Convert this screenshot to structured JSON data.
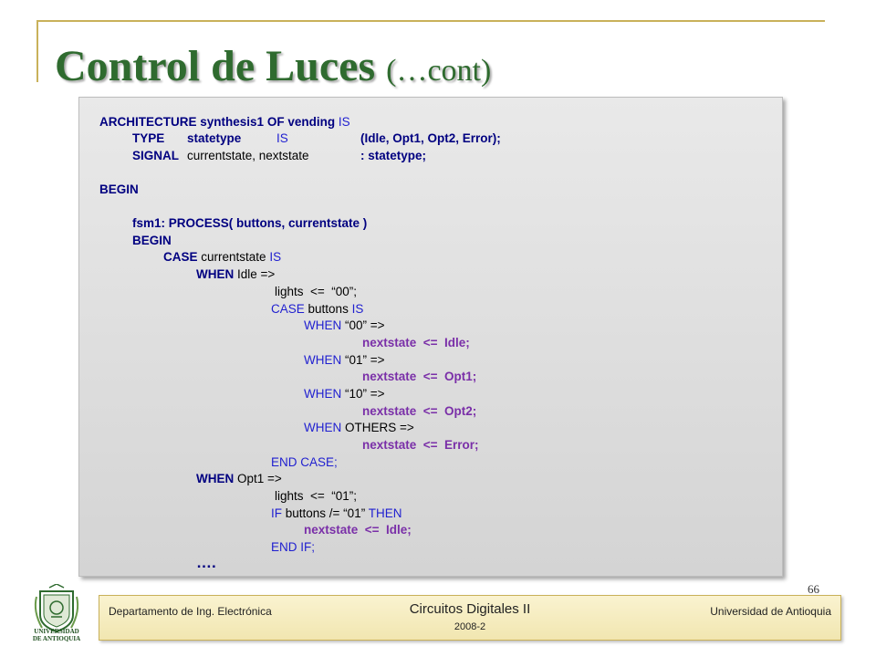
{
  "slide": {
    "title": "Control de Luces",
    "title_suffix": "(…cont)",
    "page_number": "66"
  },
  "code": {
    "l1_a": "ARCHITECTURE",
    "l1_b": "synthesis1",
    "l1_c": "OF",
    "l1_d": "vending",
    "l1_e": "IS",
    "l2_a": "TYPE",
    "l2_b": "statetype",
    "l2_c": "IS",
    "l2_d": "(Idle, Opt1, Opt2, Error);",
    "l3_a": "SIGNAL",
    "l3_b": "currentstate, nextstate",
    "l3_c": ": statetype;",
    "l4": "BEGIN",
    "l5": "fsm1: PROCESS( buttons, currentstate )",
    "l6": "BEGIN",
    "l7_a": "CASE",
    "l7_b": "currentstate",
    "l7_c": "IS",
    "l8_a": "WHEN",
    "l8_b": "Idle =>",
    "l9": "lights  <=  “00”;",
    "l10_a": "CASE",
    "l10_b": "buttons",
    "l10_c": "IS",
    "l11_a": "WHEN",
    "l11_b": "“00” =>",
    "l12": "nextstate  <=  Idle;",
    "l13_a": "WHEN",
    "l13_b": "“01” =>",
    "l14": "nextstate  <=  Opt1;",
    "l15_a": "WHEN",
    "l15_b": "“10” =>",
    "l16": "nextstate  <=  Opt2;",
    "l17_a": "WHEN",
    "l17_b": "OTHERS =>",
    "l18": "nextstate  <=  Error;",
    "l19": "END CASE;",
    "l20_a": "WHEN",
    "l20_b": "Opt1 =>",
    "l21": "lights  <=  “01”;",
    "l22_a": "IF",
    "l22_b": "buttons /= “01”",
    "l22_c": "THEN",
    "l23": "nextstate  <=  Idle;",
    "l24": "END IF;",
    "l25": "…."
  },
  "footer": {
    "department": "Departamento de Ing. Electrónica",
    "course": "Circuitos Digitales II",
    "semester": "2008-2",
    "university": "Universidad de Antioquia",
    "logo_text_line1": "UNIVERSIDAD",
    "logo_text_line2": "DE ANTIOQUIA"
  },
  "colors": {
    "title_green": "#2f6b2f",
    "keyword_blue": "#1f1fd0",
    "navy_bold": "#000080",
    "purple_bold": "#7a2fa8",
    "accent_gold": "#c9b15a"
  }
}
